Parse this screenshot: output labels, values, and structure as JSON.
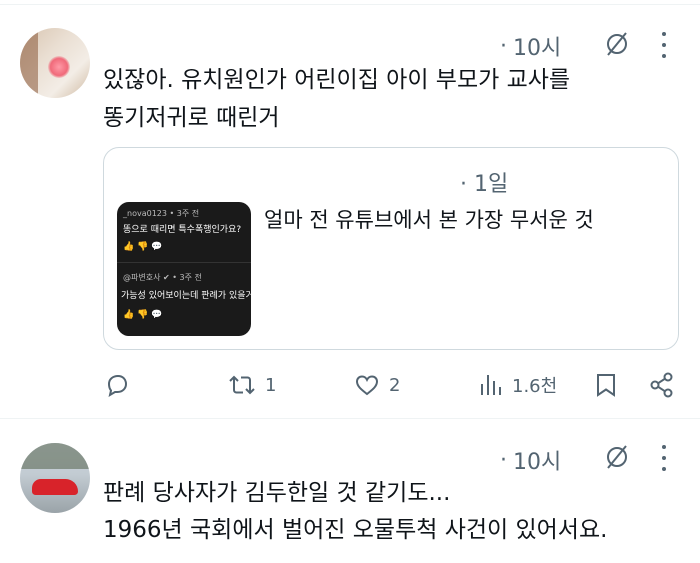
{
  "posts": [
    {
      "time": "10시",
      "text_lines": [
        "있잖아. 유치원인가 어린이집 아이 부모가 교사를",
        "똥기저귀로 때린거"
      ],
      "quote": {
        "time": "1일",
        "title": "얼마 전 유튜브에서 본 가장 무서운 것",
        "thumb_rows": [
          "_nova0123 • 3주 전",
          "똥으로 때리면 특수폭행인가요?",
          "👍  👎  💬",
          "@파변호사 ✔ • 3주 전",
          "가능성 있어보이는데 판례가 있을거",
          "👍  👎  💬"
        ]
      },
      "actions": {
        "reply_count": "",
        "repost_count": "1",
        "like_count": "2",
        "views_count": "1.6천"
      }
    },
    {
      "time": "10시",
      "text_lines": [
        "판례 당사자가 김두한일 것 같기도...",
        "1966년 국회에서 벌어진 오물투척 사건이 있어서요."
      ]
    }
  ],
  "colors": {
    "text": "#0f1419",
    "secondary": "#536471",
    "border": "#cfd9de",
    "divider": "#eff3f4"
  },
  "icons": [
    "mute-icon",
    "more-icon",
    "reply-icon",
    "repost-icon",
    "like-icon",
    "views-icon",
    "bookmark-icon",
    "share-icon"
  ]
}
